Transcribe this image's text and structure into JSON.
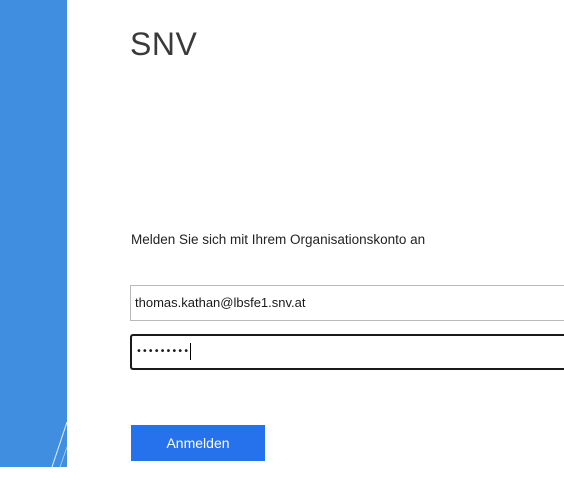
{
  "brand": {
    "title": "SNV"
  },
  "login": {
    "prompt": "Melden Sie sich mit Ihrem Organisationskonto an",
    "email_value": "thomas.kathan@lbsfe1.snv.at",
    "password_masked": "•••••••••",
    "submit_label": "Anmelden"
  },
  "colors": {
    "side_panel": "#3f8ee0",
    "button": "#2672ec",
    "button_text": "#ffffff"
  }
}
